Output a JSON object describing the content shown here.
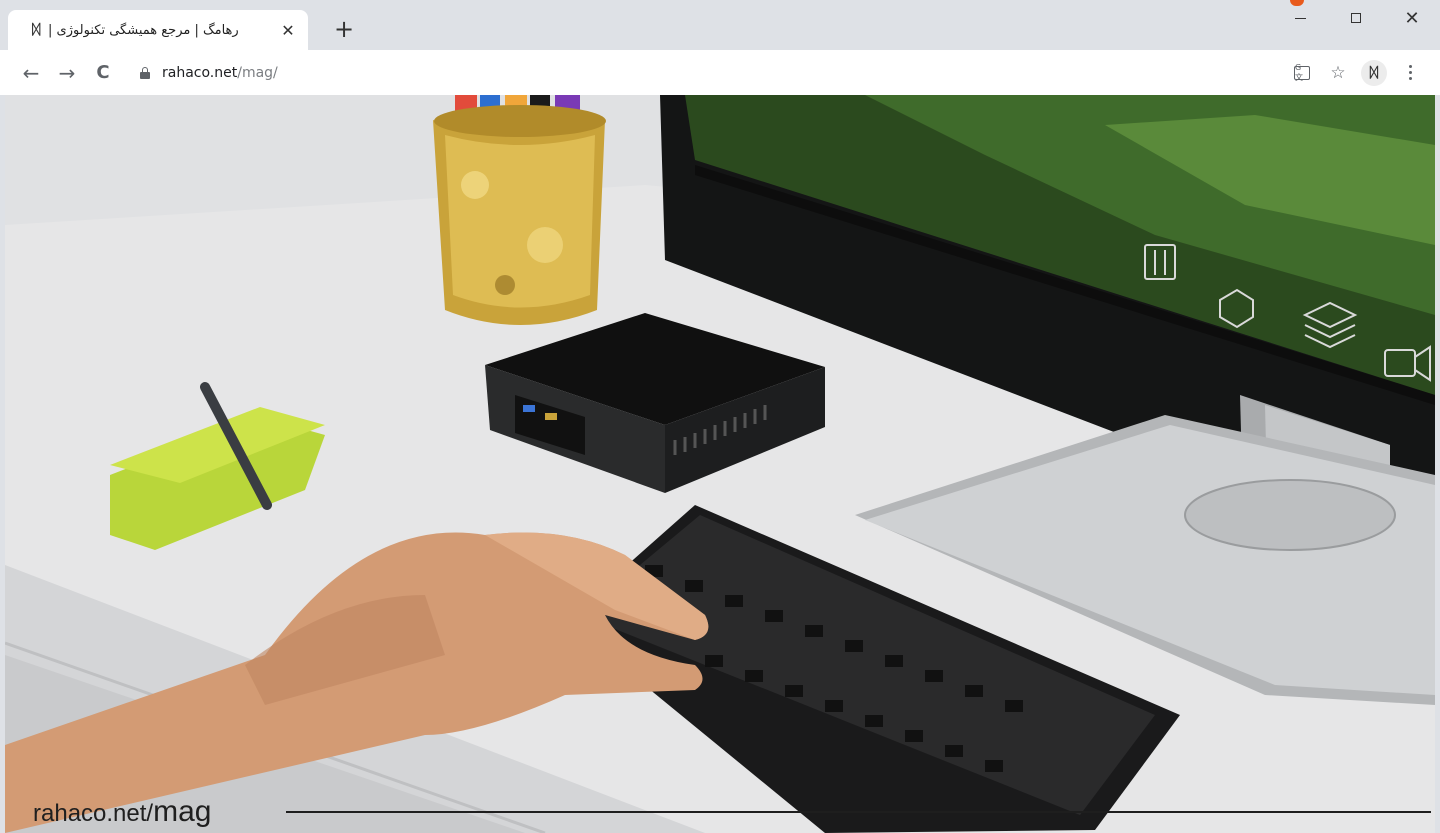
{
  "browser": {
    "tab": {
      "title": "رهامگ | مرجع همیشگی تکنولوژی |",
      "favicon": "rahaco-logo-icon",
      "close_glyph": "✕"
    },
    "new_tab_glyph": "+",
    "window_controls": {
      "minimize": "minimize-icon",
      "maximize": "maximize-icon",
      "close_glyph": "✕"
    },
    "nav": {
      "back_glyph": "←",
      "forward_glyph": "→",
      "reload_glyph": "C"
    },
    "omnibox": {
      "host": "rahaco.net",
      "path": "/mag/"
    },
    "toolbar_icons": [
      "translate-icon",
      "star-icon",
      "extension-icon",
      "menu-icon"
    ],
    "star_glyph": "☆"
  },
  "page": {
    "image_description_icons": [
      "equalizer-icon",
      "cube-icon",
      "layers-icon",
      "video-camera-icon"
    ],
    "watermark": {
      "host": "rahaco.net/",
      "path": "mag"
    }
  },
  "colors": {
    "tabstrip": "#dee1e6",
    "toolbar": "#ffffff",
    "accent_orange": "#e85a1c",
    "text_primary": "#202124",
    "text_muted": "#7b7e82"
  }
}
